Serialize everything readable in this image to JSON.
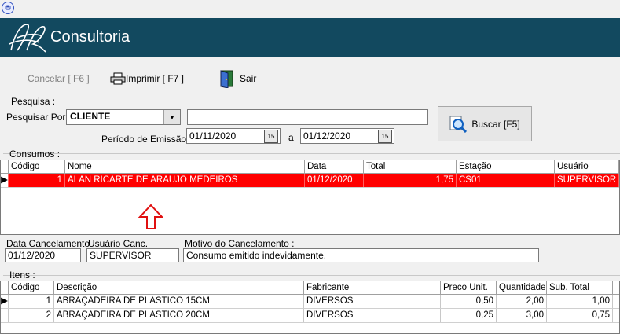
{
  "header": {
    "title": "Consultoria"
  },
  "toolbar": {
    "cancel_label": "Cancelar [ F6 ]",
    "print_label": "Imprimir [ F7 ]",
    "exit_label": "Sair"
  },
  "search": {
    "group_label": "Pesquisa :",
    "by_label": "Pesquisar Por:",
    "by_value": "CLIENTE",
    "text_value": "",
    "period_label": "Período de Emissão:",
    "date_from": "01/11/2020",
    "date_sep": "a",
    "date_to": "01/12/2020",
    "button_label": "Buscar [F5]"
  },
  "consumos": {
    "group_label": "Consumos :",
    "columns": [
      "Código",
      "Nome",
      "Data",
      "Total",
      "Estação",
      "Usuário"
    ],
    "rows": [
      {
        "codigo": "1",
        "nome": "ALAN RICARTE DE ARAUJO MEDEIROS",
        "data": "01/12/2020",
        "total": "1,75",
        "estacao": "CS01",
        "usuario": "SUPERVISOR"
      }
    ]
  },
  "cancel_info": {
    "date_label": "Data Cancelamento",
    "date_value": "01/12/2020",
    "user_label": "Usuário Canc.",
    "user_value": "SUPERVISOR",
    "reason_label": "Motivo do Cancelamento  :",
    "reason_value": "Consumo emitido indevidamente."
  },
  "itens": {
    "group_label": "Itens :",
    "columns": [
      "Código",
      "Descrição",
      "Fabricante",
      "Preco Unit.",
      "Quantidade",
      "Sub. Total"
    ],
    "rows": [
      {
        "codigo": "1",
        "descricao": "ABRAÇADEIRA DE PLASTICO 15CM",
        "fabricante": "DIVERSOS",
        "preco": "0,50",
        "quantidade": "2,00",
        "subtotal": "1,00"
      },
      {
        "codigo": "2",
        "descricao": "ABRAÇADEIRA DE PLASTICO 20CM",
        "fabricante": "DIVERSOS",
        "preco": "0,25",
        "quantidade": "3,00",
        "subtotal": "0,75"
      }
    ]
  },
  "colors": {
    "header_bg": "#12495f",
    "selected_row": "#ff0000",
    "arrow": "#e01010"
  }
}
